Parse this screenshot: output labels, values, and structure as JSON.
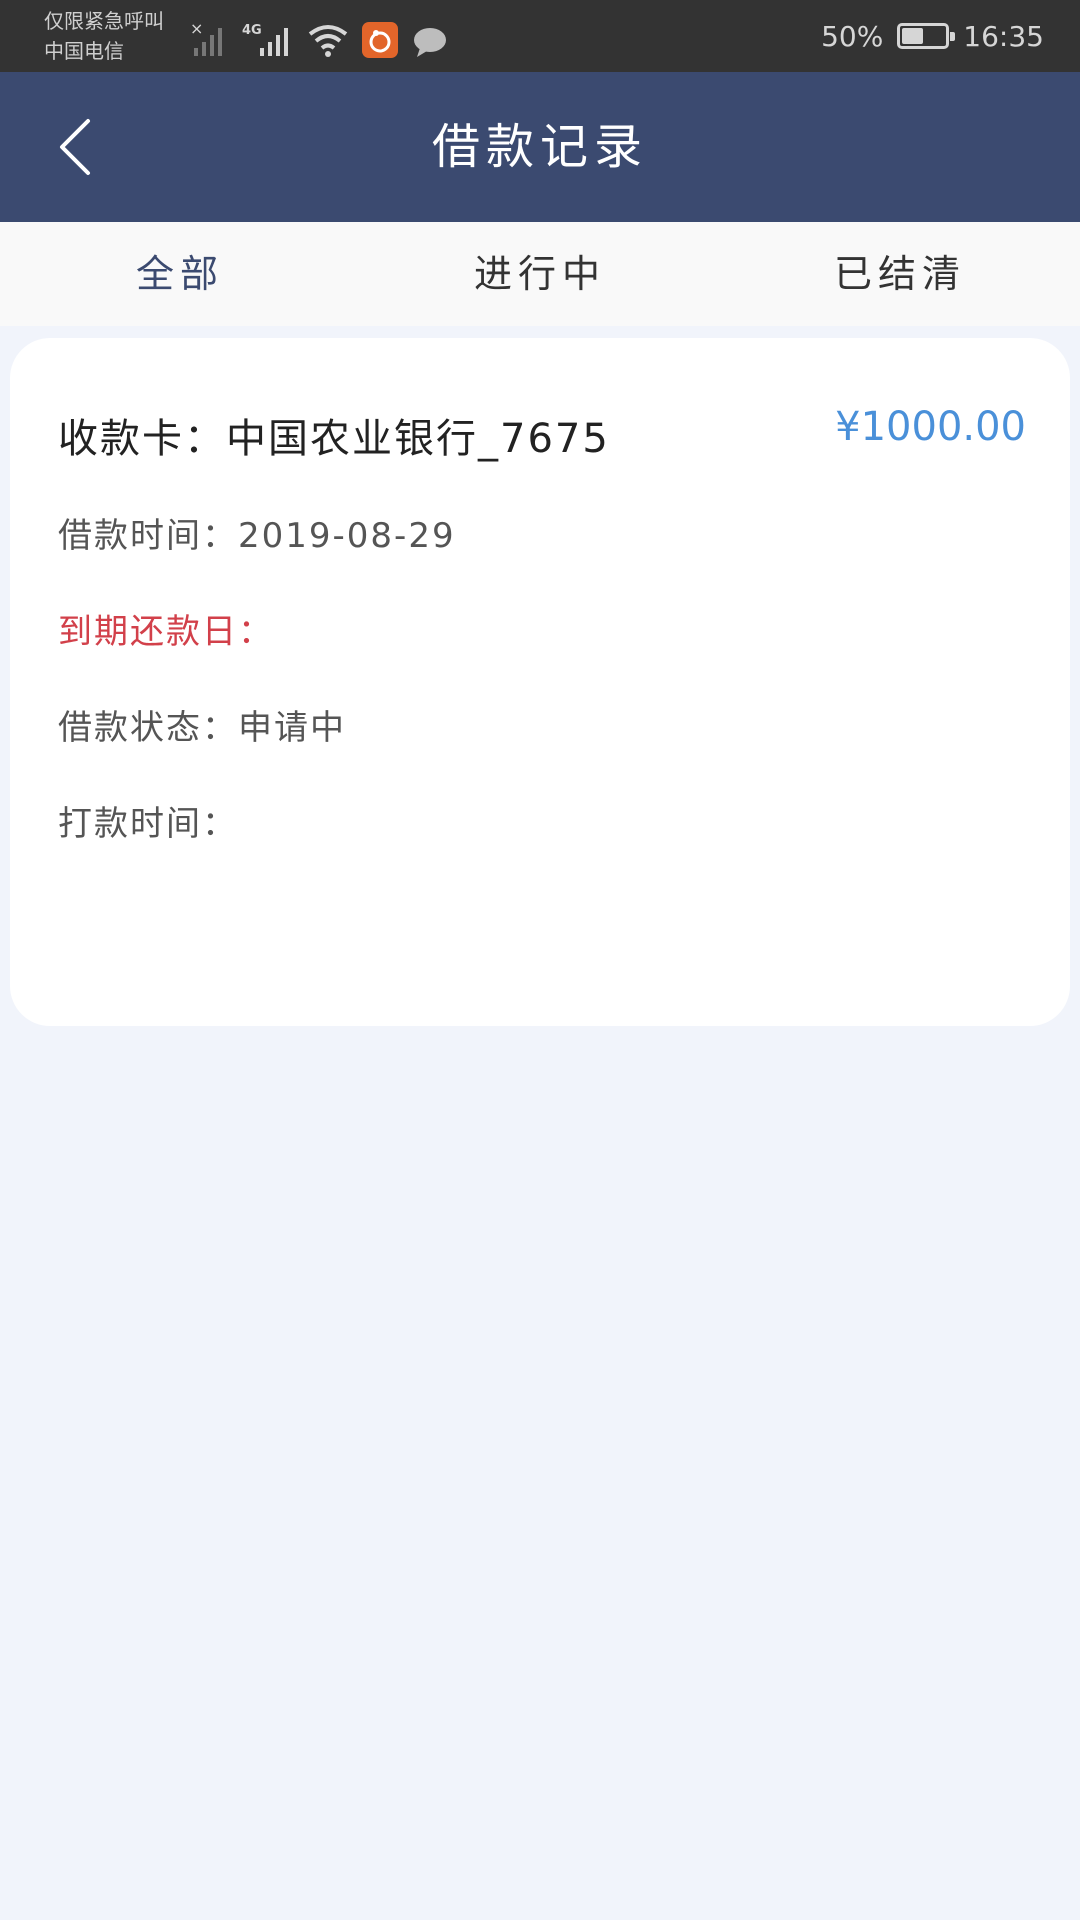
{
  "status_bar": {
    "carrier_line1": "仅限紧急呼叫",
    "carrier_line2": "中国电信",
    "network": "4G",
    "battery_text": "50%",
    "battery_level": 0.5,
    "time": "16:35"
  },
  "header": {
    "title": "借款记录"
  },
  "tabs": [
    {
      "label": "全部"
    },
    {
      "label": "进行中"
    },
    {
      "label": "已结清"
    }
  ],
  "record": {
    "card_label": "收款卡：",
    "card_value": "中国农业银行_7675",
    "amount": "¥1000.00",
    "loan_time_label": "借款时间：",
    "loan_time_value": "2019-08-29",
    "due_label": "到期还款日：",
    "due_value": "",
    "status_label": "借款状态：",
    "status_value": "申请中",
    "pay_time_label": "打款时间：",
    "pay_time_value": ""
  },
  "colors": {
    "header_bg": "#3b4a70",
    "accent_blue": "#4a90d9",
    "due_red": "#d2404a",
    "page_bg": "#f1f4fb"
  }
}
